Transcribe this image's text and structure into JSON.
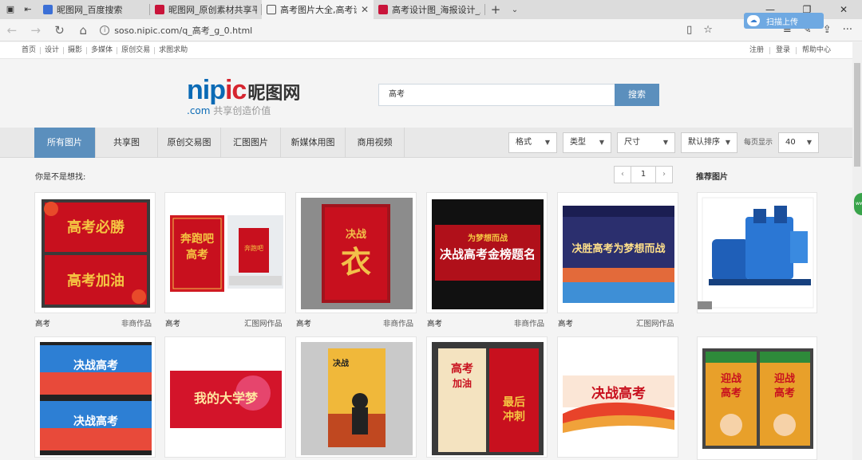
{
  "browser": {
    "tabs": [
      {
        "title": "昵图网_百度搜索",
        "active": false
      },
      {
        "title": "昵图网_原创素材共享平台w",
        "active": false
      },
      {
        "title": "高考图片大全,高考设计",
        "active": true
      },
      {
        "title": "高考设计图_海报设计_广告",
        "active": false
      }
    ],
    "url": "soso.nipic.com/q_高考_g_0.html",
    "scan_upload": "扫描上传"
  },
  "site_nav": {
    "left": [
      "首页",
      "设计",
      "摄影",
      "多媒体",
      "原创交易",
      "求图求助"
    ],
    "right": [
      "注册",
      "登录",
      "帮助中心"
    ]
  },
  "logo": {
    "nip": "nip",
    "ic": "ic",
    "cn": "昵图网",
    "sub_dot": ".com",
    "sub": "共享创造价值"
  },
  "search": {
    "value": "高考",
    "button": "搜索"
  },
  "categories": [
    "所有图片",
    "共享图",
    "原创交易图",
    "汇图图片",
    "新媒体用图",
    "商用视频"
  ],
  "filters": [
    {
      "label": "格式"
    },
    {
      "label": "类型"
    },
    {
      "label": "尺寸"
    },
    {
      "label": "默认排序"
    }
  ],
  "perpage_label": "每页显示",
  "perpage_value": "40",
  "hint": "你是不是想找:",
  "pager": {
    "prev": "‹",
    "page": "1",
    "next": "›"
  },
  "recommend_title": "推荐图片",
  "results_row1": [
    {
      "title": "高考",
      "tag": "非商作品",
      "art": "高考必胜 / 高考加油"
    },
    {
      "title": "高考",
      "tag": "汇图网作品",
      "art": "奔跑吧高考"
    },
    {
      "title": "高考",
      "tag": "非商作品",
      "art": "决战 高考 · 衣"
    },
    {
      "title": "高考",
      "tag": "非商作品",
      "art": "为梦想而战 决战高考金榜题名"
    },
    {
      "title": "高考",
      "tag": "汇图网作品",
      "art": "决胜高考为梦想而战"
    }
  ],
  "results_row2": [
    {
      "art": "决战高考 / 决战高考"
    },
    {
      "art": "我的大学梦"
    },
    {
      "art": "决战高考"
    },
    {
      "art": "高考加油 / 最后冲刺"
    },
    {
      "art": "决战高考"
    }
  ],
  "recommend": [
    {
      "art": "compressor"
    },
    {
      "art": "迎战高考"
    }
  ],
  "colors": {
    "accent": "#5b8fbd",
    "poster_red": "#c8101e",
    "brand_blue": "#0a6ab5",
    "brand_red": "#d6252f"
  }
}
